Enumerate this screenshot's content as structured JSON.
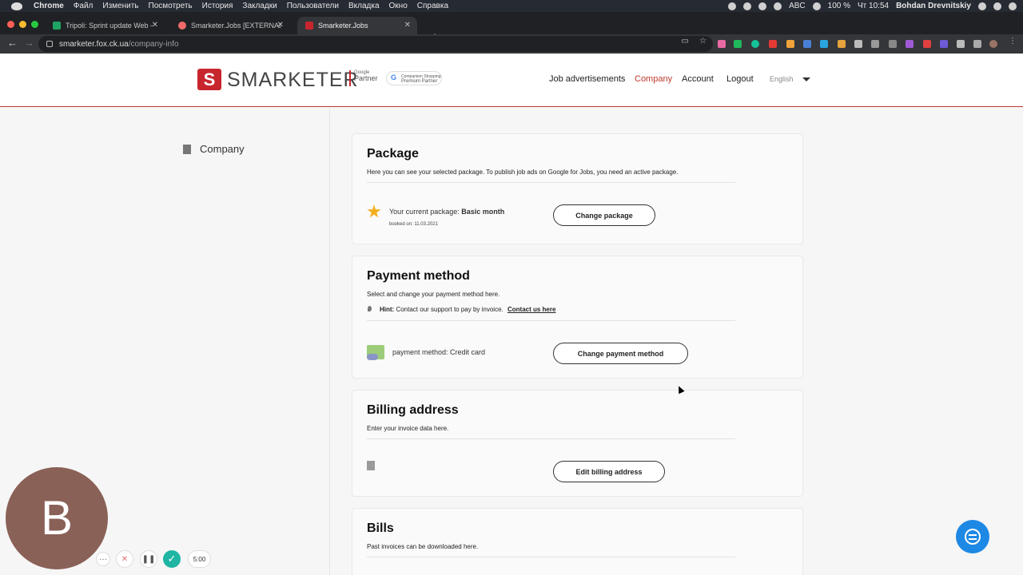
{
  "menubar": {
    "app": "Chrome",
    "items": [
      "Файл",
      "Изменить",
      "Посмотреть",
      "История",
      "Закладки",
      "Пользователи",
      "Вкладка",
      "Окно",
      "Справка"
    ],
    "input_source": "ABC",
    "battery": "100 %",
    "clock": "Чт 10:54",
    "user": "Bohdan Drevnitskiy"
  },
  "tabs": [
    {
      "title": "Tripoli: Sprint update Web - Go",
      "favicon_color": "#1fa463"
    },
    {
      "title": "Smarketer.Jobs [EXTERNAL",
      "favicon_color": "#f06a6a"
    },
    {
      "title": "Smarketer.Jobs",
      "favicon_color": "#c8262d"
    }
  ],
  "address": {
    "host": "smarketer.fox.ck.ua",
    "path": "/company-info"
  },
  "site": {
    "logo_mark": "S",
    "logo_text": "SMARKETER",
    "google_partner_small": "Google",
    "google_partner_big": "Partner",
    "css_partner_line1": "Comparison Shopping",
    "css_partner_line2": "Premium Partner",
    "nav": [
      "Job advertisements",
      "Company",
      "Account",
      "Logout"
    ],
    "language": "English"
  },
  "sidebar": {
    "item": "Company"
  },
  "package": {
    "title": "Package",
    "desc": "Here you can see your selected package. To publish job ads on Google for Jobs, you need an active package.",
    "current_label": "Your current package:",
    "current_value": "Basic month",
    "booked": "booked on: 11.03.2021",
    "button": "Change package"
  },
  "payment": {
    "title": "Payment method",
    "desc": "Select and change your payment method here.",
    "hint_label": "Hint:",
    "hint_text": "Contact our support to pay by invoice.",
    "hint_link": "Contact us here",
    "method": "payment method: Credit card",
    "button": "Change payment method"
  },
  "billing": {
    "title": "Billing address",
    "desc": "Enter your invoice data here.",
    "button": "Edit billing address"
  },
  "bills": {
    "title": "Bills",
    "desc": "Past invoices can be downloaded here."
  },
  "recorder": {
    "avatar_letter": "B",
    "more": "···",
    "timer": "5:00"
  }
}
